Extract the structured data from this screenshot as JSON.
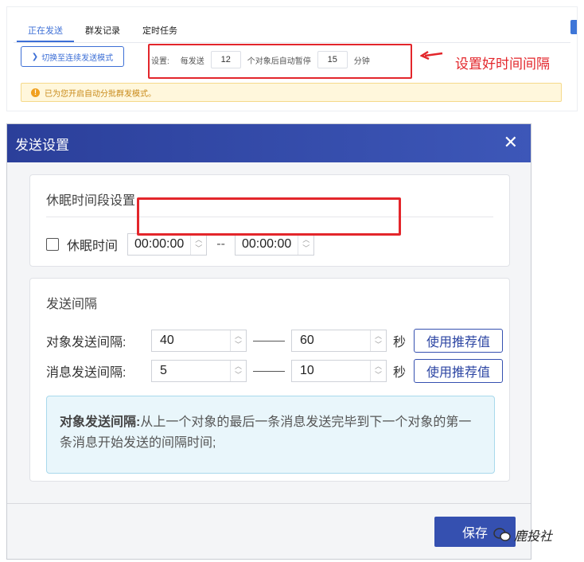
{
  "top": {
    "tabs": [
      "正在发送",
      "群发记录",
      "定时任务"
    ],
    "active_tab": 0,
    "switch_button": "切换至连续发送模式",
    "settings": {
      "label": "设置:",
      "each_send_label": "每发送",
      "each_send_value": "12",
      "pause_after_label": "个对象后自动暂停",
      "pause_value": "15",
      "unit": "分钟"
    },
    "annotation": "设置好时间间隔",
    "info": "已为您开启自动分批群发模式。"
  },
  "dialog": {
    "title": "发送设置",
    "sleep_section": {
      "title": "休眠时间段设置",
      "checkbox_label": "休眠时间",
      "checked": false,
      "start": "00:00:00",
      "separator": "--",
      "end": "00:00:00"
    },
    "interval_section": {
      "title": "发送间隔",
      "rows": [
        {
          "label": "对象发送间隔:",
          "from": "40",
          "to": "60",
          "unit": "秒",
          "button": "使用推荐值"
        },
        {
          "label": "消息发送间隔:",
          "from": "5",
          "to": "10",
          "unit": "秒",
          "button": "使用推荐值"
        }
      ],
      "tip_bold": "对象发送间隔:",
      "tip_text": "从上一个对象的最后一条消息发送完毕到下一个对象的第一条消息开始发送的间隔时间;"
    },
    "save_button": "保存"
  },
  "watermark": "鹿投社",
  "colors": {
    "accent": "#3550b0",
    "annotation_red": "#e3262b",
    "header": "#2b3f9a"
  }
}
